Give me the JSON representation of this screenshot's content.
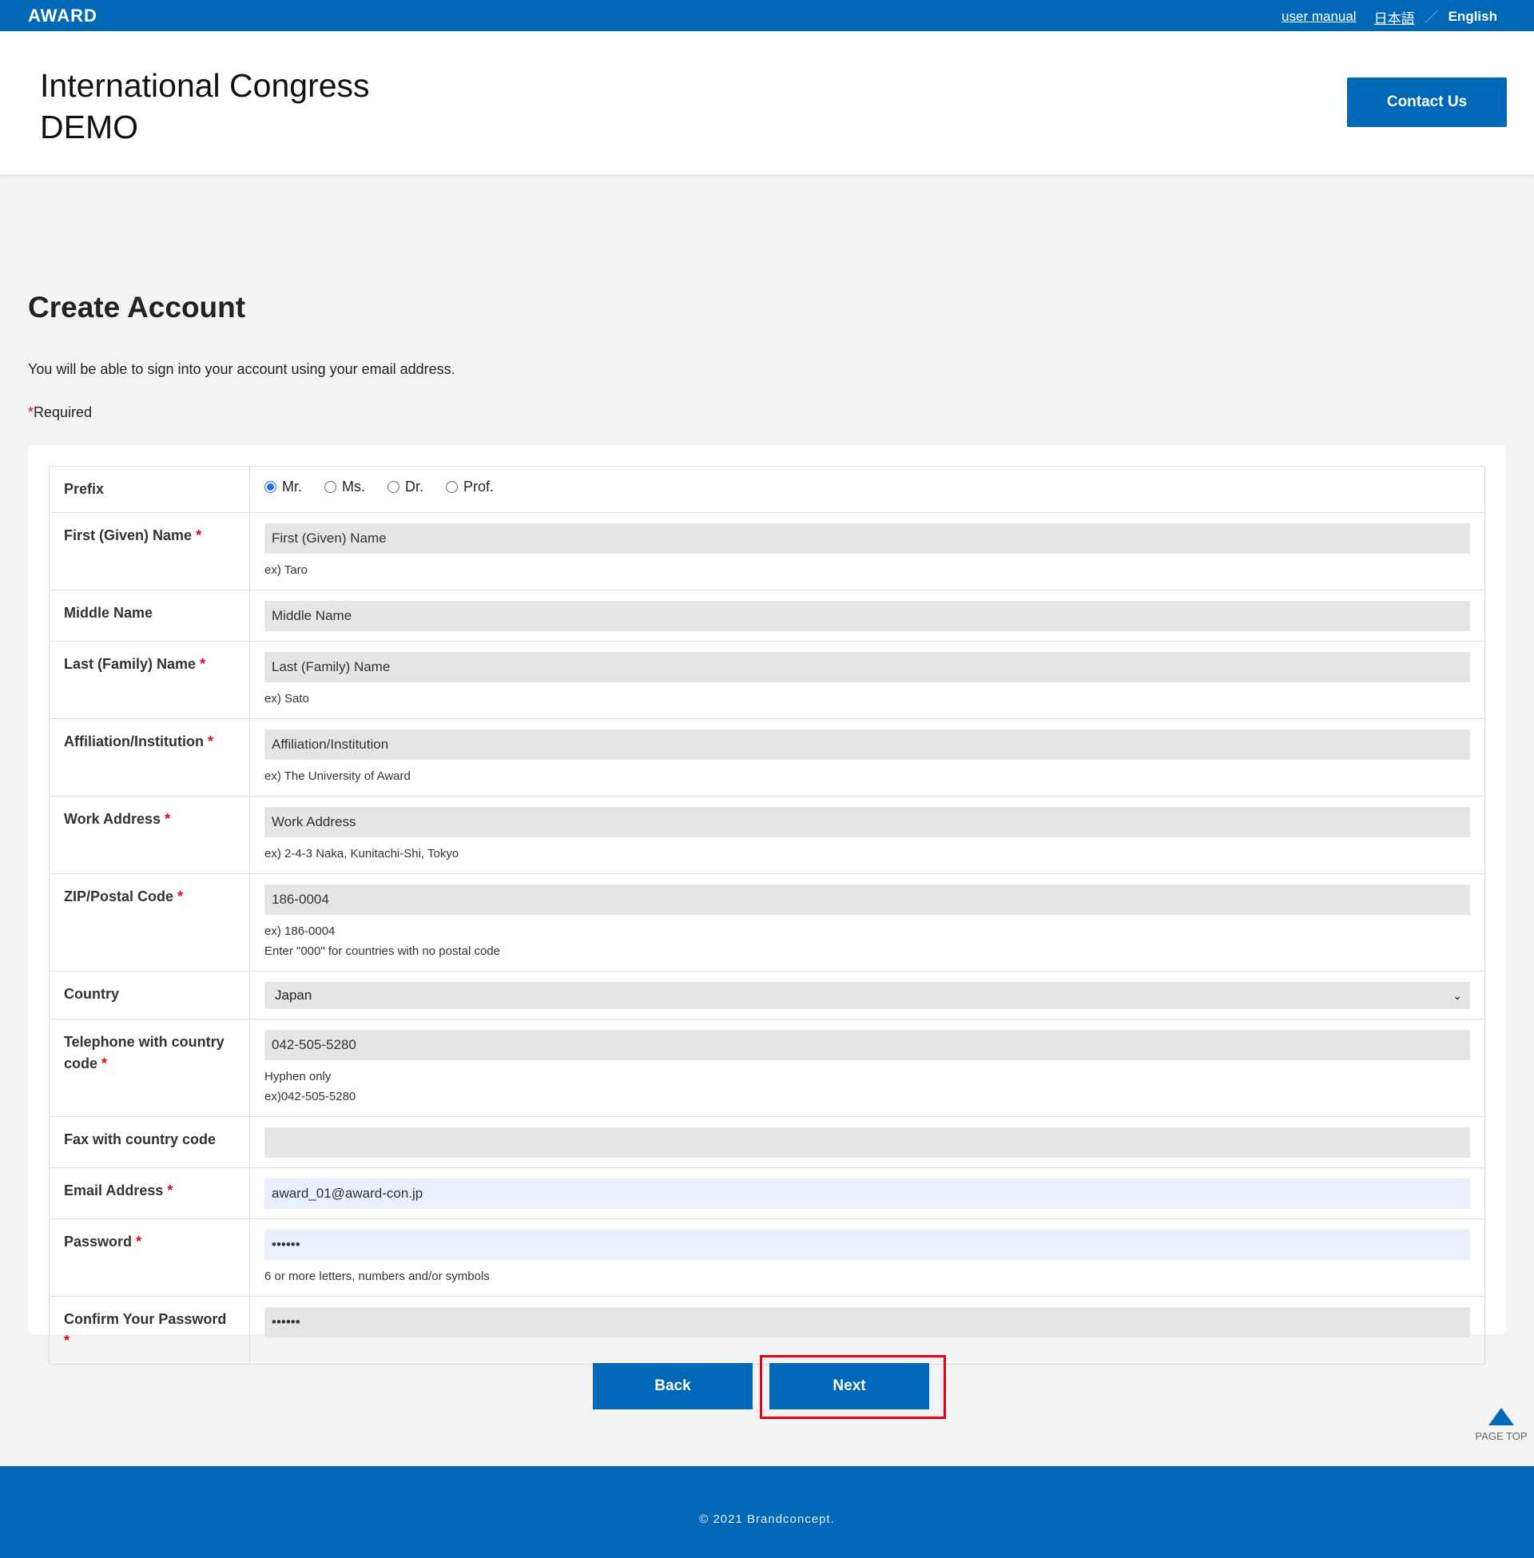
{
  "topbar": {
    "brand": "AWARD",
    "user_manual": "user manual",
    "lang_ja": "日本語",
    "separator": "／",
    "lang_en": "English"
  },
  "header": {
    "title": "International Congress\nDEMO",
    "contact_label": "Contact Us"
  },
  "page": {
    "heading": "Create Account",
    "intro": "You will be able to sign into your account using your email address.",
    "required_star": "*",
    "required_label": "Required"
  },
  "form": {
    "prefix": {
      "label": "Prefix",
      "options": [
        "Mr.",
        "Ms.",
        "Dr.",
        "Prof."
      ],
      "selected": "Mr."
    },
    "first_name": {
      "label": "First (Given) Name",
      "value": "First (Given) Name",
      "hint": "ex) Taro"
    },
    "middle_name": {
      "label": "Middle Name",
      "value": "Middle Name"
    },
    "last_name": {
      "label": "Last (Family) Name",
      "value": "Last (Family) Name",
      "hint": "ex) Sato"
    },
    "affiliation": {
      "label": "Affiliation/Institution",
      "value": "Affiliation/Institution",
      "hint": "ex) The University of Award"
    },
    "work_address": {
      "label": "Work Address",
      "value": "Work Address",
      "hint": "ex) 2-4-3 Naka, Kunitachi-Shi, Tokyo"
    },
    "zip": {
      "label": "ZIP/Postal Code",
      "value": "186-0004",
      "hint1": "ex) 186-0004",
      "hint2": "Enter \"000\" for countries with no postal code"
    },
    "country": {
      "label": "Country",
      "value": "Japan"
    },
    "telephone": {
      "label": "Telephone with country code",
      "value": "042-505-5280",
      "hint1": "Hyphen only",
      "hint2": "ex)042-505-5280"
    },
    "fax": {
      "label": "Fax with country code",
      "value": ""
    },
    "email": {
      "label": "Email Address",
      "value": "award_01@award-con.jp"
    },
    "password": {
      "label": "Password",
      "value": "••••••",
      "hint": "6 or more letters, numbers and/or symbols"
    },
    "confirm_password": {
      "label": "Confirm Your Password",
      "value": "••••••"
    }
  },
  "actions": {
    "back": "Back",
    "next": "Next"
  },
  "page_top": "PAGE TOP",
  "footer": {
    "copyright": "© 2021 Brandconcept."
  },
  "colors": {
    "brand_blue": "#0068b7",
    "required_red": "#e60012",
    "highlight_red": "#e60012"
  }
}
